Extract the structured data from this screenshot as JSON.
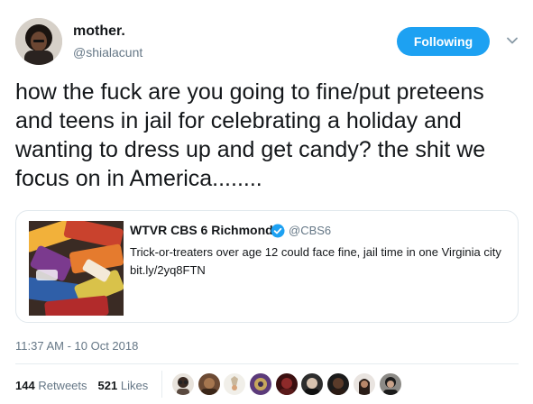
{
  "author": {
    "display_name": "mother.",
    "handle": "@shialacunt"
  },
  "follow_button": {
    "label": "Following"
  },
  "tweet": {
    "text": "how the fuck are you going to fine/put preteens and teens in jail for celebrating a holiday and wanting to dress up and get candy? the shit we focus on in America........"
  },
  "quoted_tweet": {
    "author_name": "WTVR CBS 6 Richmond",
    "handle": "@CBS6",
    "text": "Trick-or-treaters over age 12 could face fine, jail time in one Virginia city bit.ly/2yq8FTN"
  },
  "timestamp": "11:37 AM - 10 Oct 2018",
  "stats": {
    "retweets_count": "144",
    "retweets_label": "Retweets",
    "likes_count": "521",
    "likes_label": "Likes"
  },
  "colors": {
    "accent": "#1da1f2",
    "secondary_text": "#657786",
    "border": "#e1e8ed"
  },
  "icons": [
    "chevron-down-icon",
    "verified-icon"
  ]
}
